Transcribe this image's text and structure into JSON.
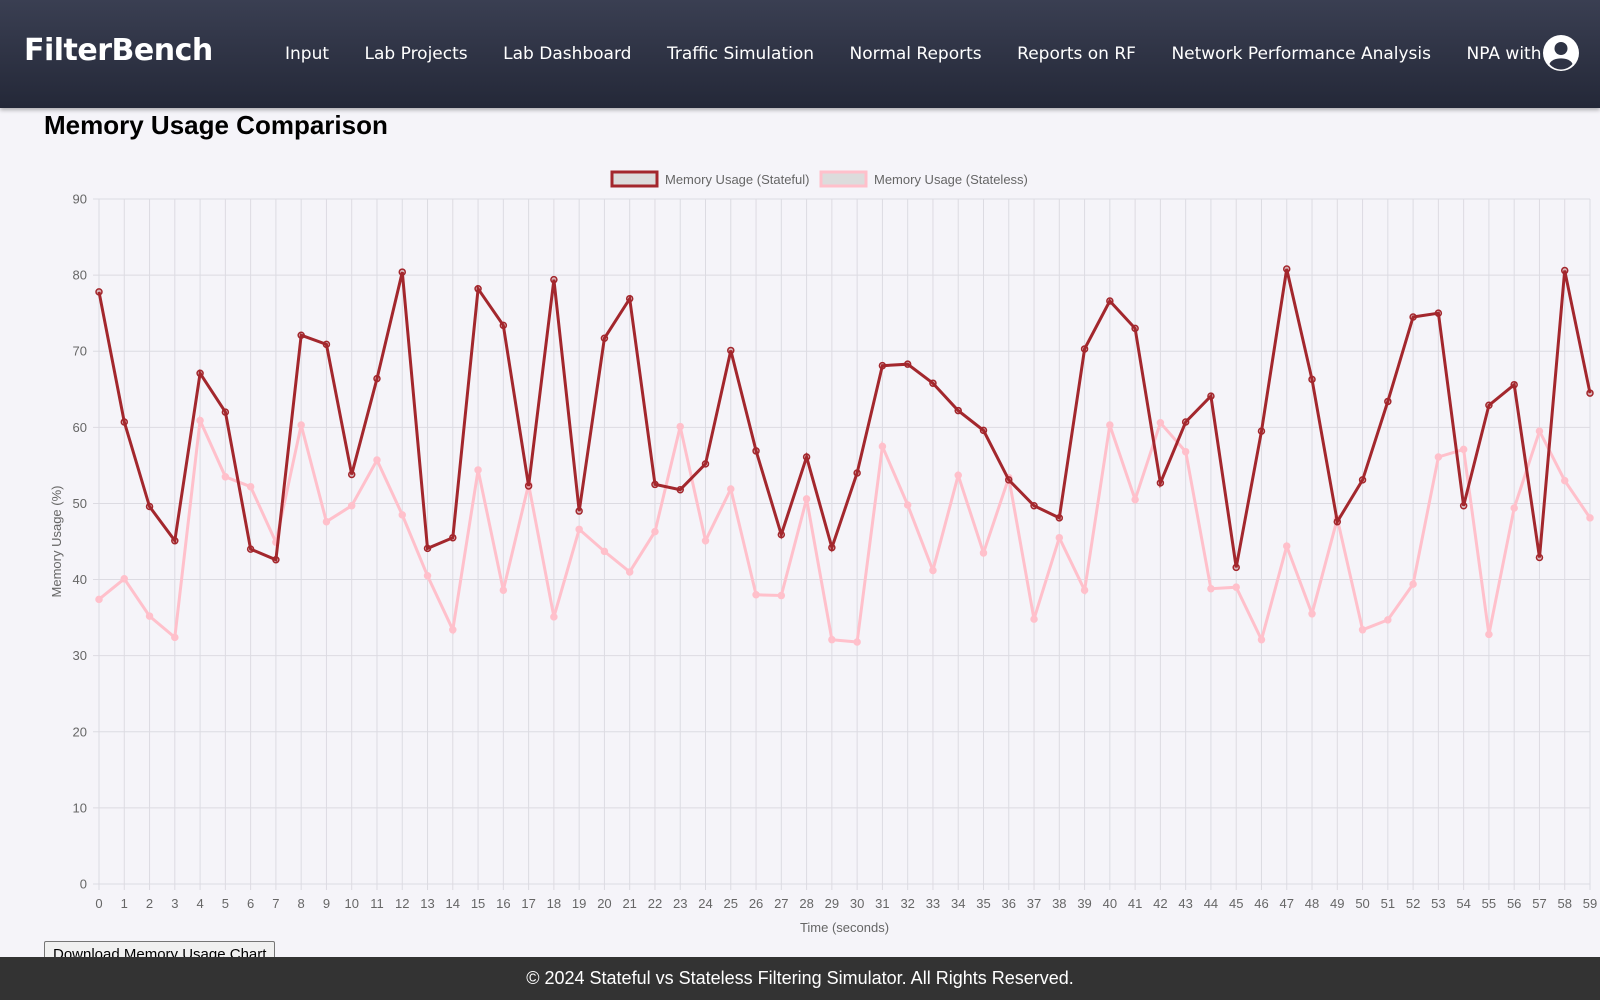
{
  "app": {
    "brand": "FilterBench",
    "nav": [
      "Input",
      "Lab Projects",
      "Lab Dashboard",
      "Traffic Simulation",
      "Normal Reports",
      "Reports on RF",
      "Network Performance Analysis",
      "NPA with RF"
    ]
  },
  "page": {
    "title": "Memory Usage Comparison",
    "download_label": "Download Memory Usage Chart"
  },
  "footer": {
    "text": "© 2024 Stateful vs Stateless Filtering Simulator. All Rights Reserved."
  },
  "colors": {
    "stateful": "#a3272d",
    "stateless": "#ffc0cb",
    "grid": "#dcdbe2",
    "tick_text": "#666666"
  },
  "chart_data": {
    "type": "line",
    "xlabel": "Time (seconds)",
    "ylabel": "Memory Usage (%)",
    "ylim": [
      0,
      90
    ],
    "yticks": [
      0,
      10,
      20,
      30,
      40,
      50,
      60,
      70,
      80,
      90
    ],
    "grid": true,
    "legend_position": "top",
    "x": [
      0,
      1,
      2,
      3,
      4,
      5,
      6,
      7,
      8,
      9,
      10,
      11,
      12,
      13,
      14,
      15,
      16,
      17,
      18,
      19,
      20,
      21,
      22,
      23,
      24,
      25,
      26,
      27,
      28,
      29,
      30,
      31,
      32,
      33,
      34,
      35,
      36,
      37,
      38,
      39,
      40,
      41,
      42,
      43,
      44,
      45,
      46,
      47,
      48,
      49,
      50,
      51,
      52,
      53,
      54,
      55,
      56,
      57,
      58,
      59
    ],
    "series": [
      {
        "name": "Memory Usage (Stateful)",
        "values": [
          77.8,
          60.7,
          49.6,
          45.1,
          67.1,
          62.0,
          44.0,
          42.6,
          72.1,
          70.9,
          53.8,
          66.4,
          80.4,
          44.1,
          45.5,
          78.2,
          73.4,
          52.3,
          79.4,
          49.0,
          71.7,
          76.9,
          52.5,
          51.8,
          55.2,
          70.1,
          56.9,
          45.9,
          56.1,
          44.2,
          54.0,
          68.1,
          68.3,
          65.8,
          62.2,
          59.6,
          53.1,
          49.7,
          48.1,
          70.3,
          76.6,
          73.0,
          52.7,
          60.7,
          64.1,
          41.6,
          59.5,
          80.8,
          66.3,
          47.6,
          53.1,
          63.4,
          74.5,
          75.0,
          49.7,
          62.9,
          65.6,
          42.9,
          80.6,
          64.5
        ]
      },
      {
        "name": "Memory Usage (Stateless)",
        "values": [
          37.4,
          40.1,
          35.2,
          32.4,
          60.9,
          53.5,
          52.2,
          44.9,
          60.3,
          47.6,
          49.7,
          55.7,
          48.5,
          40.5,
          33.4,
          54.4,
          38.6,
          52.5,
          35.1,
          46.6,
          43.7,
          41.0,
          46.3,
          60.1,
          45.1,
          51.9,
          38.0,
          37.9,
          50.6,
          32.1,
          31.8,
          57.5,
          49.8,
          41.2,
          53.7,
          43.5,
          53.4,
          34.8,
          45.5,
          38.6,
          60.3,
          50.5,
          60.6,
          56.8,
          38.8,
          39.0,
          32.1,
          44.4,
          35.5,
          48.0,
          33.4,
          34.7,
          39.4,
          56.1,
          57.1,
          32.8,
          49.4,
          59.5,
          53.0,
          48.1
        ]
      }
    ]
  }
}
